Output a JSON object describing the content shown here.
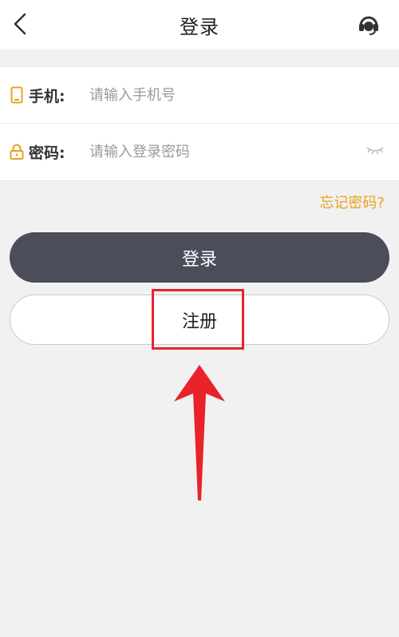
{
  "header": {
    "title": "登录",
    "back_icon": "chevron-left-icon",
    "support_icon": "headset-icon"
  },
  "form": {
    "phone": {
      "label": "手机:",
      "placeholder": "请输入手机号",
      "icon": "phone-icon"
    },
    "password": {
      "label": "密码:",
      "placeholder": "请输入登录密码",
      "icon": "lock-icon",
      "toggle_icon": "eye-closed-icon"
    }
  },
  "forgot_password": "忘记密码?",
  "buttons": {
    "login": "登录",
    "register": "注册"
  },
  "colors": {
    "accent": "#e8a21e",
    "primary_button": "#4b4d5a",
    "annotation": "#e8232a"
  }
}
